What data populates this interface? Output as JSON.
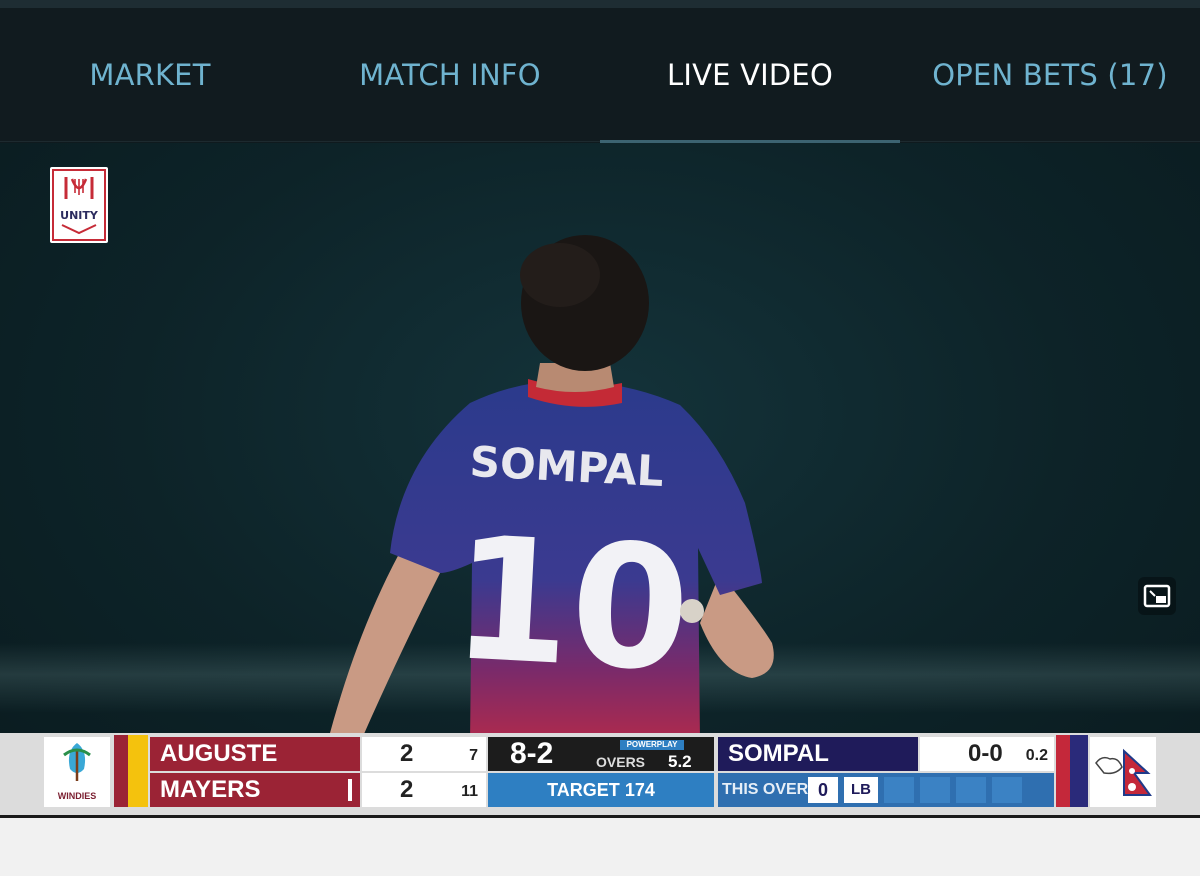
{
  "tabs": [
    {
      "label": "MARKET",
      "active": false
    },
    {
      "label": "MATCH INFO",
      "active": false
    },
    {
      "label": "LIVE VIDEO",
      "active": true
    },
    {
      "label": "OPEN BETS (17)",
      "active": false
    }
  ],
  "video": {
    "logo_text": "UNITY",
    "player_name": "SOMPAL",
    "player_number": "10"
  },
  "scoreboard": {
    "team_left": "WINDIES",
    "batters": [
      {
        "name": "AUGUSTE",
        "runs": "2",
        "balls": "7"
      },
      {
        "name": "MAYERS",
        "runs": "2",
        "balls": "11"
      }
    ],
    "score": "8-2",
    "powerplay_label": "POWERPLAY",
    "overs_label": "OVERS",
    "overs": "5.2",
    "target_label": "TARGET",
    "target": "174",
    "bowler_name": "SOMPAL",
    "bowler_figures": "0-0",
    "bowler_overs": "0.2",
    "this_over_label": "THIS OVER",
    "this_over_balls": [
      "0",
      "LB"
    ]
  },
  "colors": {
    "tab_inactive": "#6fb3cf",
    "tab_active": "#ffffff",
    "batter_panel": "#9b2335",
    "score_panel": "#1c1c1c",
    "target_panel": "#2e7fc2",
    "bowler_panel": "#1f1b5a",
    "this_over_panel": "#2f6fb0"
  }
}
